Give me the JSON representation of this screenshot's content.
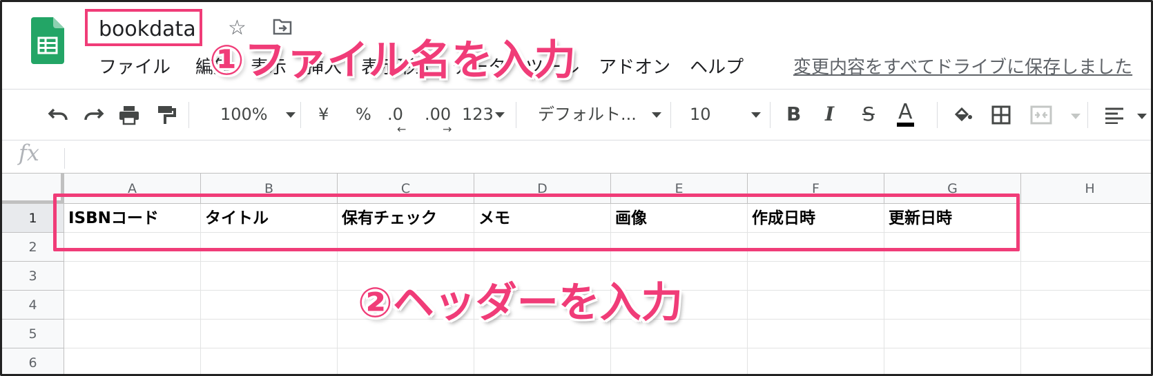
{
  "doc": {
    "title": "bookdata",
    "menu": [
      "ファイル",
      "編集",
      "表示",
      "挿入",
      "表示形式",
      "データ",
      "ツール",
      "アドオン",
      "ヘルプ"
    ],
    "save_status": "変更内容をすべてドライブに保存しました"
  },
  "toolbar": {
    "zoom": "100%",
    "currency": "¥",
    "percent": "%",
    "decimal_decrease": ".0",
    "decimal_increase": ".00",
    "more_formats": "123",
    "font": "デフォルト...",
    "font_size": "10",
    "bold": "B",
    "italic": "I",
    "strike": "S",
    "text_color": "A"
  },
  "formula_bar": {
    "fx": "fx",
    "value": ""
  },
  "grid": {
    "columns": [
      "A",
      "B",
      "C",
      "D",
      "E",
      "F",
      "G",
      "H"
    ],
    "rows": [
      "1",
      "2",
      "3",
      "4",
      "5",
      "6"
    ],
    "row1": [
      "ISBNコード",
      "タイトル",
      "保有チェック",
      "メモ",
      "画像",
      "作成日時",
      "更新日時",
      ""
    ]
  },
  "annotations": {
    "step1": "①ファイル名を入力",
    "step2": "②ヘッダーを入力"
  },
  "colors": {
    "accent": "#f03c78",
    "sheets_green": "#23a566"
  }
}
